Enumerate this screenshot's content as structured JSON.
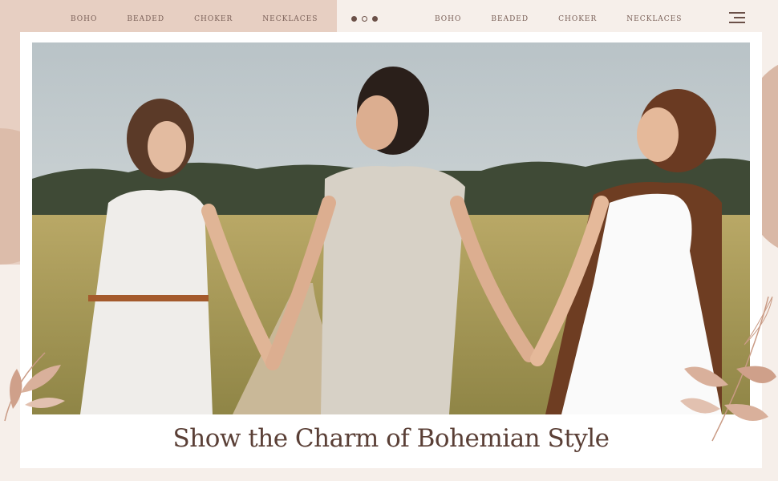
{
  "nav_left": [
    "BOHO",
    "BEADED",
    "CHOKER",
    "NECKLACES"
  ],
  "nav_right": [
    "BOHO",
    "BEADED",
    "CHOKER",
    "NECKLACES"
  ],
  "carousel": {
    "active_index": 0,
    "count": 3
  },
  "menu_icon": "hamburger-icon",
  "headline": "Show the Charm of Bohemian Style",
  "colors": {
    "background": "#f6efea",
    "accent": "#e7cfc2",
    "text": "#5a3f36"
  }
}
